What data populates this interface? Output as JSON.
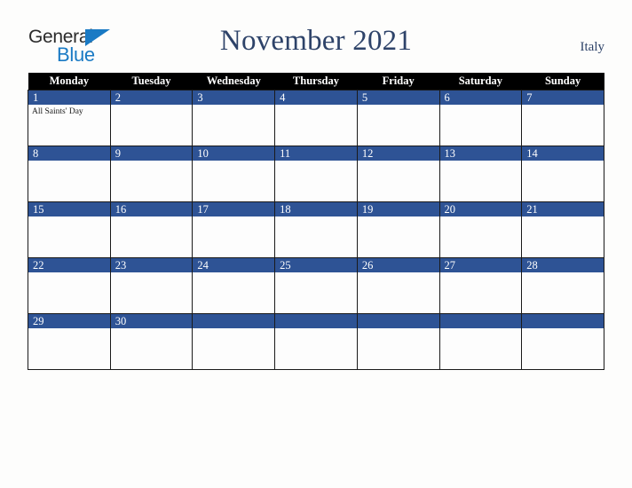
{
  "brand": {
    "word1": "General",
    "word2": "Blue",
    "triangle_color": "#1a7ac4",
    "word1_color": "#2b2b2b",
    "word2_color": "#1a7ac4"
  },
  "header": {
    "title": "November 2021",
    "country": "Italy",
    "title_color": "#2e4369"
  },
  "colors": {
    "header_row_bg": "#000000",
    "header_row_text": "#ffffff",
    "day_band_bg": "#2e5395",
    "day_band_text": "#ffffff",
    "cell_bg": "#fdfdfd",
    "grid_border": "#1a1a1a",
    "page_bg": "#fdfdfc"
  },
  "calendar": {
    "month": "November",
    "year": "2021",
    "weekday_headers": [
      "Monday",
      "Tuesday",
      "Wednesday",
      "Thursday",
      "Friday",
      "Saturday",
      "Sunday"
    ],
    "weeks": [
      [
        {
          "day": "1",
          "events": [
            "All Saints' Day"
          ]
        },
        {
          "day": "2",
          "events": []
        },
        {
          "day": "3",
          "events": []
        },
        {
          "day": "4",
          "events": []
        },
        {
          "day": "5",
          "events": []
        },
        {
          "day": "6",
          "events": []
        },
        {
          "day": "7",
          "events": []
        }
      ],
      [
        {
          "day": "8",
          "events": []
        },
        {
          "day": "9",
          "events": []
        },
        {
          "day": "10",
          "events": []
        },
        {
          "day": "11",
          "events": []
        },
        {
          "day": "12",
          "events": []
        },
        {
          "day": "13",
          "events": []
        },
        {
          "day": "14",
          "events": []
        }
      ],
      [
        {
          "day": "15",
          "events": []
        },
        {
          "day": "16",
          "events": []
        },
        {
          "day": "17",
          "events": []
        },
        {
          "day": "18",
          "events": []
        },
        {
          "day": "19",
          "events": []
        },
        {
          "day": "20",
          "events": []
        },
        {
          "day": "21",
          "events": []
        }
      ],
      [
        {
          "day": "22",
          "events": []
        },
        {
          "day": "23",
          "events": []
        },
        {
          "day": "24",
          "events": []
        },
        {
          "day": "25",
          "events": []
        },
        {
          "day": "26",
          "events": []
        },
        {
          "day": "27",
          "events": []
        },
        {
          "day": "28",
          "events": []
        }
      ],
      [
        {
          "day": "29",
          "events": []
        },
        {
          "day": "30",
          "events": []
        },
        {
          "day": "",
          "events": []
        },
        {
          "day": "",
          "events": []
        },
        {
          "day": "",
          "events": []
        },
        {
          "day": "",
          "events": []
        },
        {
          "day": "",
          "events": []
        }
      ]
    ]
  }
}
